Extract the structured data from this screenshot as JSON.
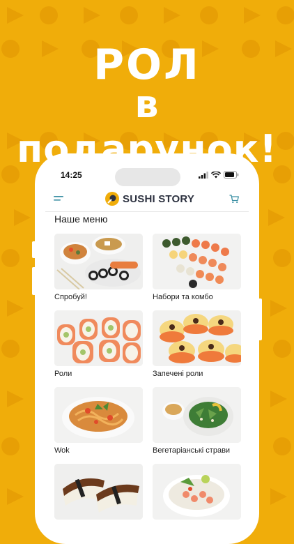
{
  "promo": {
    "line1": "РОЛ",
    "line2": "в подарунок!"
  },
  "status_bar": {
    "time": "14:25"
  },
  "app_bar": {
    "brand": "SUSHI STORY"
  },
  "menu": {
    "title": "Наше меню",
    "items": [
      {
        "label": "Спробуй!"
      },
      {
        "label": "Набори та комбо"
      },
      {
        "label": "Роли"
      },
      {
        "label": "Запечені роли"
      },
      {
        "label": "Wok"
      },
      {
        "label": "Вегетаріанські страви"
      },
      {
        "label": ""
      },
      {
        "label": ""
      }
    ]
  },
  "colors": {
    "background": "#f0ad0a",
    "accent": "#f0ad0a",
    "brand_text": "#2d3240",
    "cart": "#3a8fa3"
  }
}
